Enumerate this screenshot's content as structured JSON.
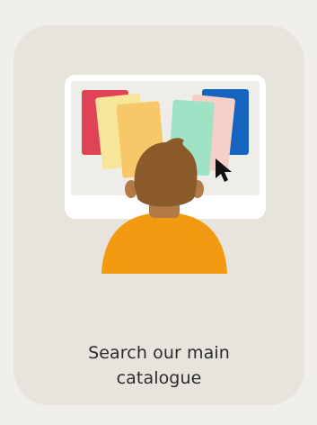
{
  "card": {
    "label_line1": "Search our main",
    "label_line2": "catalogue"
  },
  "colors": {
    "page_background": "#f1efeb",
    "card_background": "#e6e4dc",
    "monitor_frame": "#ffffff",
    "monitor_screen": "#efedea",
    "book_red": "#e04355",
    "book_yellow_light": "#f7e69a",
    "book_orange": "#f7c86a",
    "book_mint": "#9fe2c5",
    "book_pink": "#f5cfc8",
    "book_blue": "#1565c0",
    "hair": "#8a5a2b",
    "skin": "#b27a47",
    "shirt": "#f29a12",
    "cursor": "#111111"
  },
  "icons": {
    "illustration": "person-at-computer-illustration",
    "cursor": "mouse-pointer-icon"
  }
}
